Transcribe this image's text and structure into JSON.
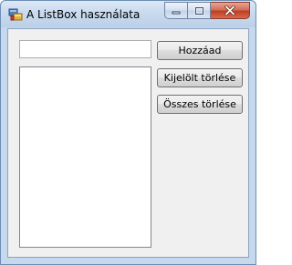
{
  "window": {
    "title": "A ListBox használata",
    "icon": "winforms-app-icon",
    "caption_buttons": {
      "minimize_icon": "minimize-icon",
      "maximize_icon": "maximize-icon",
      "close_icon": "close-icon"
    }
  },
  "form": {
    "input": {
      "value": "",
      "placeholder": ""
    },
    "listbox": {
      "items": []
    },
    "buttons": {
      "add_label": "Hozzáad",
      "remove_selected_label": "Kijelölt törlése",
      "remove_all_label": "Összes törlése"
    }
  },
  "colors": {
    "titlebar": "#c9daee",
    "client_background": "#f0f0f0",
    "close_button": "#c74a2e"
  }
}
